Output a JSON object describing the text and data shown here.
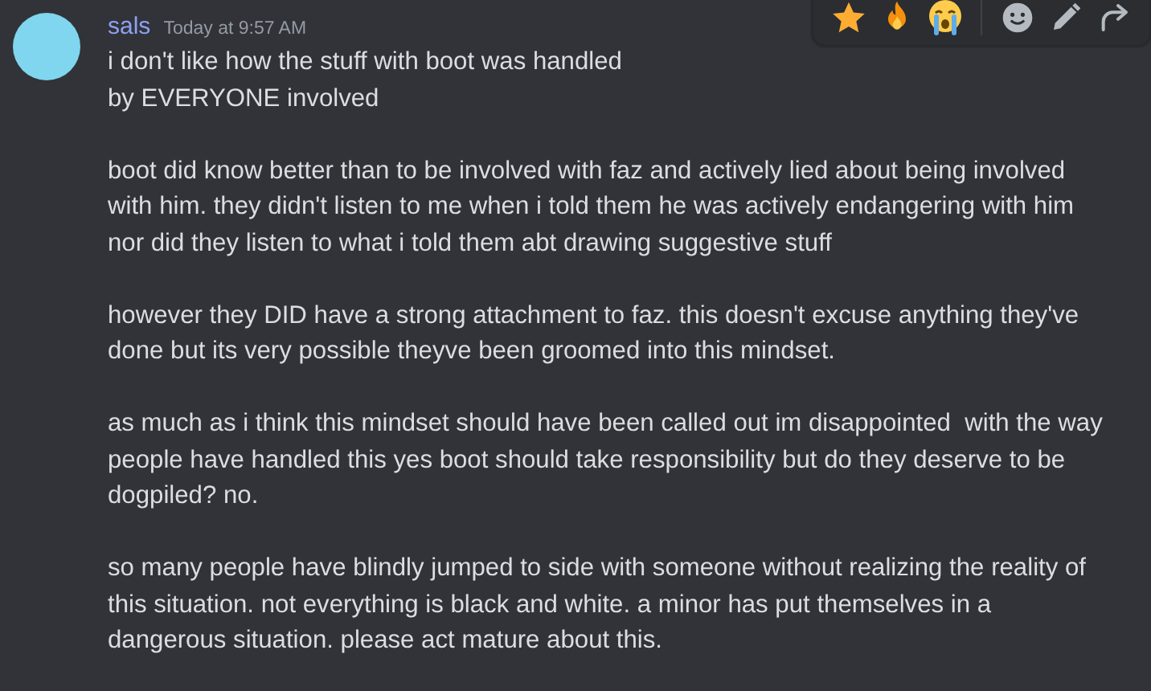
{
  "message": {
    "author": "sals",
    "timestamp": "Today at 9:57 AM",
    "paragraphs": [
      {
        "lines": [
          "i don't like how the stuff with boot was handled",
          "by EVERYONE involved"
        ]
      },
      {
        "lines": [
          "boot did know better than to be involved with faz and actively lied about being involved",
          "with him. they didn't listen to me when i told them he was actively endangering with him",
          "nor did they listen to what i told them abt drawing suggestive stuff"
        ]
      },
      {
        "lines": [
          "however they DID have a strong attachment to faz. this doesn't excuse anything they've",
          "done but its very possible theyve been groomed into this mindset."
        ]
      },
      {
        "lines": [
          "as much as i think this mindset should have been called out im disappointed  with the way",
          "people have handled this yes boot should take responsibility but do they deserve to be",
          "dogpiled? no."
        ]
      },
      {
        "lines": [
          "so many people have blindly jumped to side with someone without realizing the reality of",
          "this situation. not everything is black and white. a minor has put themselves in a",
          "dangerous situation. please act mature about this."
        ]
      }
    ]
  },
  "toolbar": {
    "actions": [
      {
        "kind": "star"
      },
      {
        "kind": "fire"
      },
      {
        "kind": "crying"
      },
      {
        "kind": "reaction"
      },
      {
        "kind": "edit"
      },
      {
        "kind": "reply"
      }
    ]
  }
}
